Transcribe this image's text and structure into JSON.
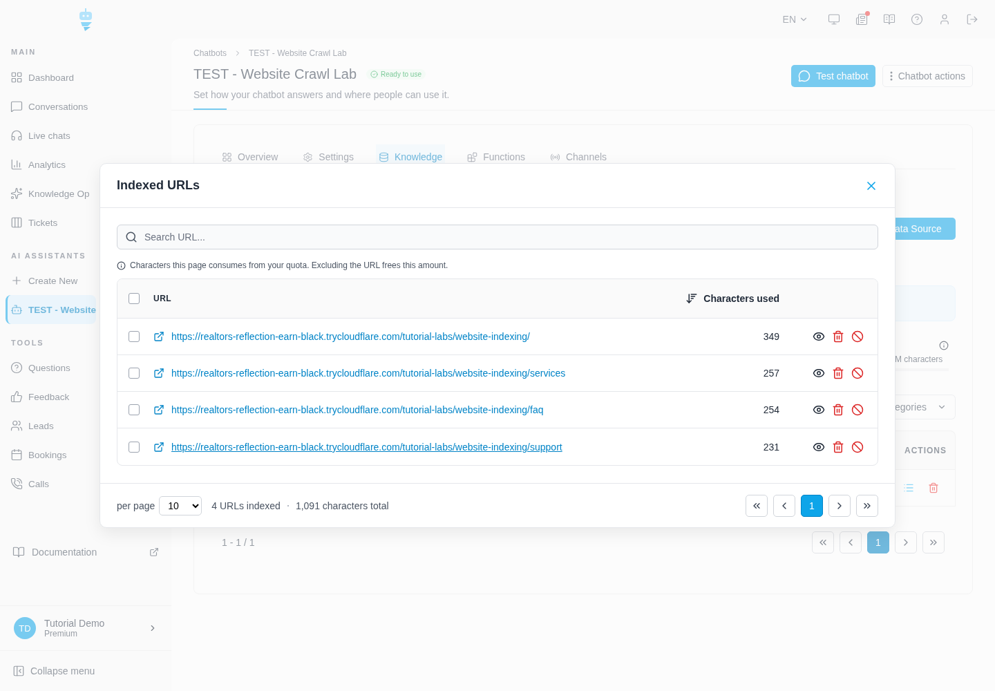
{
  "topbar": {
    "language": "EN",
    "notifications": {
      "unread": true
    }
  },
  "sidebar": {
    "sections": [
      {
        "heading": "MAIN",
        "items": [
          {
            "label": "Dashboard",
            "selected": false
          },
          {
            "label": "Conversations",
            "selected": false
          },
          {
            "label": "Live chats",
            "selected": false
          },
          {
            "label": "Analytics",
            "selected": false
          },
          {
            "label": "Knowledge Op",
            "selected": false
          },
          {
            "label": "Tickets",
            "selected": false
          }
        ]
      },
      {
        "heading": "AI ASSISTANTS",
        "items": [
          {
            "label": "Create New",
            "selected": false
          },
          {
            "label": "TEST - Website",
            "selected": true
          }
        ]
      },
      {
        "heading": "TOOLS",
        "items": [
          {
            "label": "Questions",
            "selected": false
          },
          {
            "label": "Feedback",
            "selected": false
          },
          {
            "label": "Leads",
            "selected": false
          },
          {
            "label": "Bookings",
            "selected": false
          },
          {
            "label": "Calls",
            "selected": false
          }
        ]
      }
    ],
    "documentation": "Documentation",
    "user": {
      "initials": "TD",
      "name": "Tutorial Demo",
      "plan": "Premium"
    },
    "collapse": "Collapse menu"
  },
  "header": {
    "breadcrumb": [
      "Chatbots",
      "TEST - Website Crawl Lab"
    ],
    "title": "TEST - Website Crawl Lab",
    "status": "Ready to use",
    "subtitle": "Set how your chatbot answers and where people can use it.",
    "test_button": "Test chatbot",
    "actions_button": "Chatbot actions"
  },
  "tabs": [
    {
      "label": "Overview",
      "selected": false
    },
    {
      "label": "Settings",
      "selected": false
    },
    {
      "label": "Knowledge",
      "selected": true
    },
    {
      "label": "Functions",
      "selected": false
    },
    {
      "label": "Channels",
      "selected": false
    }
  ],
  "knowledge_panel": {
    "add_button": "ata Source",
    "usage_label": "M characters",
    "filter": "egories",
    "actions_heading": "ACTIONS",
    "range": "1 - 1 / 1",
    "pages": [
      {
        "label": "1",
        "selected": true
      }
    ]
  },
  "modal": {
    "title": "Indexed URLs",
    "search": {
      "placeholder": "Search URL..."
    },
    "note": "Characters this page consumes from your quota. Excluding the URL frees this amount.",
    "all_selected": false,
    "columns": [
      "URL",
      "Characters used"
    ],
    "rows": [
      {
        "url": "https://realtors-reflection-earn-black.trycloudflare.com/tutorial-labs/website-indexing/",
        "characters": "349",
        "checked": false,
        "hovered": false
      },
      {
        "url": "https://realtors-reflection-earn-black.trycloudflare.com/tutorial-labs/website-indexing/services",
        "characters": "257",
        "checked": false,
        "hovered": false
      },
      {
        "url": "https://realtors-reflection-earn-black.trycloudflare.com/tutorial-labs/website-indexing/faq",
        "characters": "254",
        "checked": false,
        "hovered": false
      },
      {
        "url": "https://realtors-reflection-earn-black.trycloudflare.com/tutorial-labs/website-indexing/support",
        "characters": "231",
        "checked": false,
        "hovered": true
      }
    ],
    "footer": {
      "per_page_label": "per page",
      "per_page": "10",
      "count": "4 URLs indexed",
      "total": "1,091 characters total"
    },
    "pages": [
      {
        "label": "1",
        "selected": true
      }
    ]
  }
}
